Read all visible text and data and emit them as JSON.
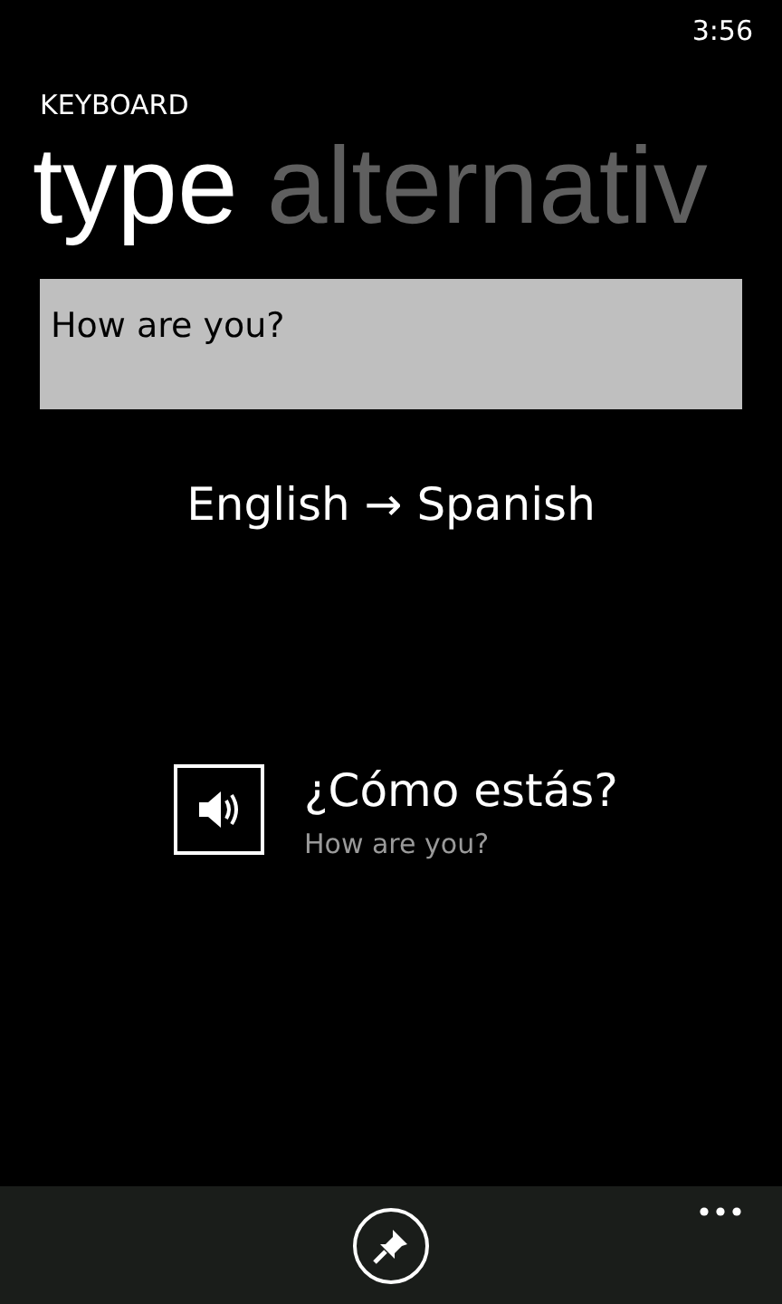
{
  "status_bar": {
    "time": "3:56"
  },
  "app_title": "KEYBOARD",
  "pivot": [
    {
      "label": "type",
      "selected": true
    },
    {
      "label": "alternativ",
      "selected": false
    }
  ],
  "input": {
    "value": "How are you?"
  },
  "language_pair": "English → Spanish",
  "translation": {
    "text": "¿Cómo estás?",
    "source": "How are you?"
  },
  "app_bar": {
    "buttons": [
      {
        "kind": "pin"
      }
    ]
  }
}
